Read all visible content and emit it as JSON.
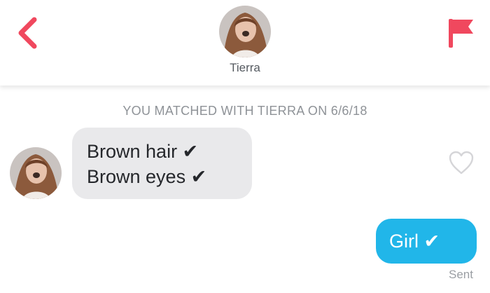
{
  "header": {
    "back_icon": "chevron-left-icon",
    "report_icon": "flag-icon",
    "contact_name": "Tierra",
    "accent_color": "#f0485e"
  },
  "conversation": {
    "match_notice": "YOU MATCHED WITH TIERRA ON 6/6/18",
    "messages": [
      {
        "direction": "incoming",
        "lines": [
          "Brown hair ✔",
          "Brown eyes ✔"
        ],
        "bubble_color": "#e9e9eb",
        "like_icon": "heart-outline-icon"
      },
      {
        "direction": "outgoing",
        "text": "Girl ✔",
        "bubble_color": "#21b6e9",
        "status": "Sent"
      }
    ]
  }
}
